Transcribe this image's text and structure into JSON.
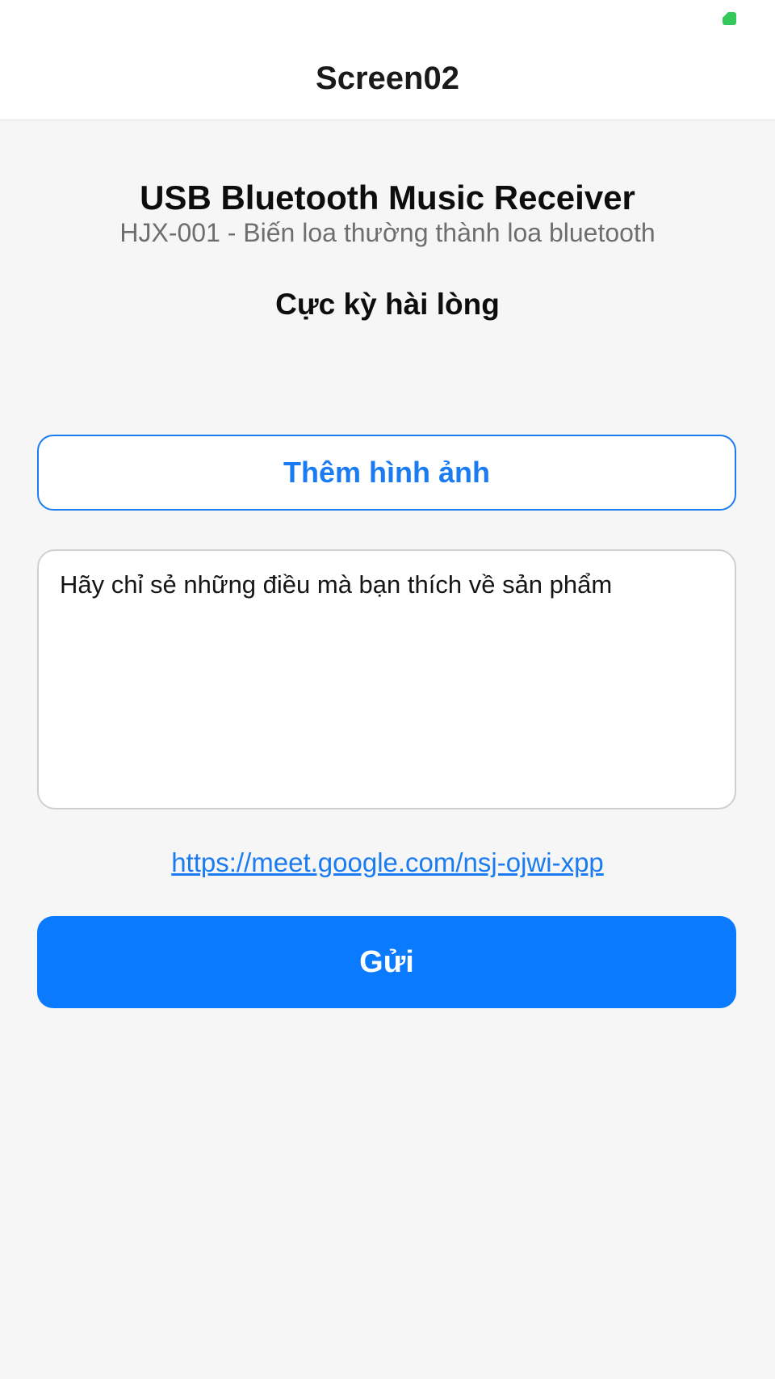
{
  "status_bar": {
    "indicator_color": "#34c759",
    "indicator_icon": "status-indicator-icon"
  },
  "nav": {
    "title": "Screen02"
  },
  "product": {
    "name": "USB Bluetooth Music Receiver",
    "subtitle": "HJX-001 - Biến loa thường thành loa bluetooth"
  },
  "rating": {
    "label": "Cực kỳ hài lòng"
  },
  "add_image_button": {
    "label": "Thêm hình ảnh"
  },
  "review": {
    "value": "",
    "placeholder": "Hãy chỉ sẻ những điều mà bạn thích về sản phẩm"
  },
  "link": {
    "text": "https://meet.google.com/nsj-ojwi-xpp"
  },
  "send_button": {
    "label": "Gửi"
  },
  "colors": {
    "accent": "#1a7cf0",
    "primary_button": "#0a7aff",
    "background": "#f6f6f6"
  }
}
